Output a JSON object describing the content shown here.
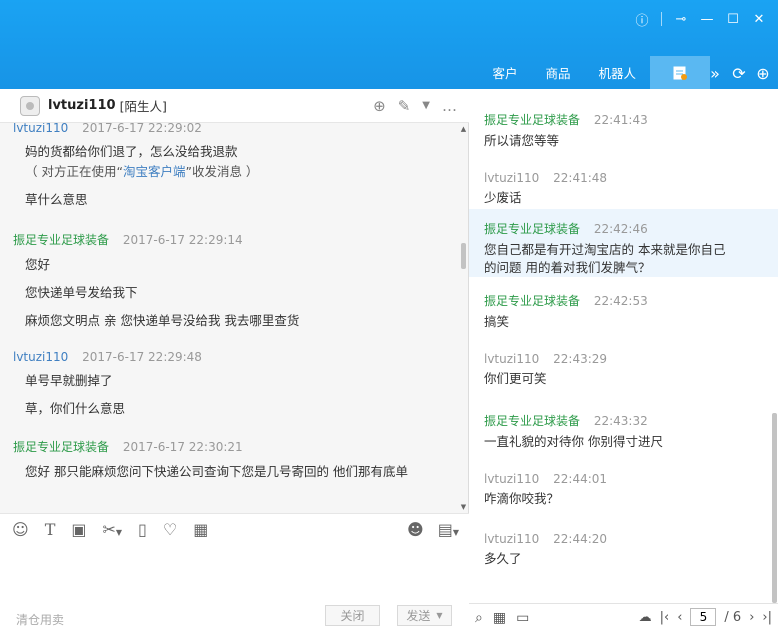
{
  "window": {
    "controls": [
      "?",
      "⊸",
      "—",
      "☐",
      "✕"
    ]
  },
  "nav": {
    "tabs": [
      {
        "label": "客户"
      },
      {
        "label": "商品"
      },
      {
        "label": "机器人"
      }
    ],
    "active_icon": "notepad-icon",
    "tools": [
      "»",
      "⟳",
      "⊕"
    ]
  },
  "chat_header": {
    "username": "lvtuzi110",
    "tag": "[陌生人]"
  },
  "left_messages": [
    {
      "sender": "lvtuzi110",
      "role": "buyer",
      "time": "2017-6-17 22:29:02",
      "lines": [
        "妈的货都给你们退了，怎么没给我退款"
      ],
      "hint_pre": "（ 对方正在使用“",
      "hint_link": "淘宝客户端",
      "hint_post": "”收发消息 ）",
      "extra": [
        "草什么意思"
      ]
    },
    {
      "sender": "振足专业足球装备",
      "role": "seller",
      "time": "2017-6-17 22:29:14",
      "lines": [
        "您好",
        "您快递单号发给我下",
        "麻烦您文明点 亲  您快递单号没给我 我去哪里查货"
      ]
    },
    {
      "sender": "lvtuzi110",
      "role": "buyer",
      "time": "2017-6-17 22:29:48",
      "lines": [
        "单号早就删掉了",
        "草，你们什么意思"
      ]
    },
    {
      "sender": "振足专业足球装备",
      "role": "seller",
      "time": "2017-6-17 22:30:21",
      "lines": [
        "您好 那只能麻烦您问下快递公司查询下您是几号寄回的 他们那有底单"
      ]
    }
  ],
  "right_messages": [
    {
      "sender": "振足专业足球装备",
      "role": "seller",
      "time": "22:41:43",
      "text": "所以请您等等"
    },
    {
      "sender": "lvtuzi110",
      "role": "buyer",
      "time": "22:41:48",
      "text": "少废话"
    },
    {
      "sender": "振足专业足球装备",
      "role": "seller",
      "time": "22:42:46",
      "text": "您自己都是有开过淘宝店的 本来就是你自己的问题  用的着对我们发脾气？"
    },
    {
      "sender": "振足专业足球装备",
      "role": "seller",
      "time": "22:42:53",
      "text": "搞笑"
    },
    {
      "sender": "lvtuzi110",
      "role": "buyer",
      "time": "22:43:29",
      "text": "你们更可笑"
    },
    {
      "sender": "振足专业足球装备",
      "role": "seller",
      "time": "22:43:32",
      "text": "一直礼貌的对待你  你别得寸进尺"
    },
    {
      "sender": "lvtuzi110",
      "role": "buyer",
      "time": "22:44:01",
      "text": "咋滴你咬我？"
    },
    {
      "sender": "lvtuzi110",
      "role": "buyer",
      "time": "22:44:20",
      "text": "多久了"
    }
  ],
  "input": {
    "placeholder": "清仓用卖",
    "close_label": "关闭",
    "send_label": "发送"
  },
  "pager": {
    "current": "5",
    "total": "/ 6"
  },
  "colors": {
    "topbar": "#1a9df0",
    "buyer": "#3f7fc1",
    "seller": "#2e9b4a"
  }
}
